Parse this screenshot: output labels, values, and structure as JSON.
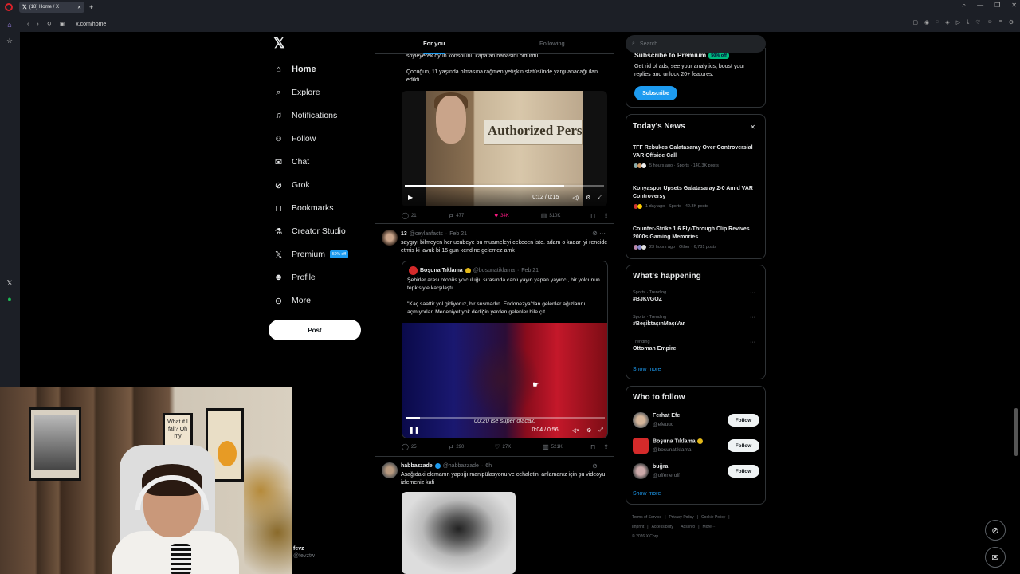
{
  "browser": {
    "tab_title": "(18) Home / X",
    "tab_icon": "x-logo-icon",
    "url": "x.com/home"
  },
  "nav": {
    "items": [
      {
        "label": "Home",
        "icon": "home-icon"
      },
      {
        "label": "Explore",
        "icon": "search-icon"
      },
      {
        "label": "Notifications",
        "icon": "bell-icon",
        "badge": "18"
      },
      {
        "label": "Follow",
        "icon": "person-add-icon"
      },
      {
        "label": "Chat",
        "icon": "mail-icon"
      },
      {
        "label": "Grok",
        "icon": "grok-icon"
      },
      {
        "label": "Bookmarks",
        "icon": "bookmark-icon"
      },
      {
        "label": "Creator Studio",
        "icon": "flask-icon"
      },
      {
        "label": "Premium",
        "icon": "x-logo-icon",
        "badge": "50% off"
      },
      {
        "label": "Profile",
        "icon": "person-icon"
      },
      {
        "label": "More",
        "icon": "more-circle-icon"
      }
    ],
    "post_label": "Post"
  },
  "account": {
    "name": "fevz",
    "handle": "@fevztw"
  },
  "feed": {
    "tabs": [
      "For you",
      "Following"
    ],
    "tweet1": {
      "text_line1": "söyleyerek oyun konsolunu kapatan babasını öldürdü.",
      "text_line2": "Çocuğun, 11 yaşında olmasına rağmen yetişkin statüsünde yargılanacağı ilan edildi.",
      "video_sign": "Authorized Pers",
      "video_time": "0:12 / 0:15",
      "video_progress": 0.8,
      "replies": "21",
      "reposts": "477",
      "likes": "34K",
      "views": "$10K"
    },
    "tweet2": {
      "name": "13",
      "handle": "@ceylanfacts",
      "date": "Feb 21",
      "text": "saygıyı bilmeyen her ucubeye bu muameleyi cekecen iste. adam o kadar iyi rencide etmis ki lavuk bi 15 gun kendine gelemez amk",
      "quote": {
        "name": "Boşuna Tıklama",
        "handle": "@bosunatiklama",
        "date": "Feb 21",
        "text1": "Şehirler arası otobüs yolculuğu sırasında canlı yayın yapan yayıncı, bir yolcunun tepkisiyle karşılaştı.",
        "text2": "\"Kaç saattir yol gidiyoruz, bir susmadın. Endonezya'dan gelenler ağızlarını açmıyorlar. Medeniyet yok dediğin yerden gelenler bile çıt ...",
        "subtitle": "00:20 ise süper olacak.",
        "video_time": "0:04 / 0:56",
        "video_progress": 0.07
      },
      "replies": "25",
      "reposts": "290",
      "likes": "27K",
      "views": "521K"
    },
    "tweet3": {
      "name": "habbazzade",
      "handle": "@habbazzade",
      "date": "6h",
      "text": "Aşağıdaki elemanın yaptığı manipülasyonu ve cehaletini anlamanız için şu videoyu izlemeniz kafi"
    }
  },
  "sidebar": {
    "search_placeholder": "Search",
    "premium": {
      "title": "Subscribe to Premium",
      "badge": "50% off",
      "text": "Get rid of ads, see your analytics, boost your replies and unlock 20+ features.",
      "button": "Subscribe"
    },
    "news": {
      "title": "Today's News",
      "items": [
        {
          "headline": "TFF Rebukes Galatasaray Over Controversial VAR Offside Call",
          "meta": "5 hours ago · Sports · 140.3K posts"
        },
        {
          "headline": "Konyaspor Upsets Galatasaray 2-0 Amid VAR Controversy",
          "meta": "1 day ago · Sports · 42.3K posts"
        },
        {
          "headline": "Counter-Strike 1.6 Fly-Through Clip Revives 2000s Gaming Memories",
          "meta": "23 hours ago · Other · 6,781 posts"
        }
      ]
    },
    "happening": {
      "title": "What's happening",
      "items": [
        {
          "context": "Sports · Trending",
          "topic": "#BJKvGOZ"
        },
        {
          "context": "Sports · Trending",
          "topic": "#BeşiktaşınMaçıVar"
        },
        {
          "context": "Trending",
          "topic": "Ottoman Empire"
        }
      ],
      "show_more": "Show more"
    },
    "who_to_follow": {
      "title": "Who to follow",
      "items": [
        {
          "name": "Ferhat Efe",
          "handle": "@efeuuc",
          "button": "Follow"
        },
        {
          "name": "Boşuna Tıklama",
          "handle": "@bosunatiklama",
          "button": "Follow"
        },
        {
          "name": "buğra",
          "handle": "@offeneroff",
          "button": "Follow"
        }
      ],
      "show_more": "Show more"
    },
    "footer": [
      "Terms of Service",
      "|",
      "Privacy Policy",
      "|",
      "Cookie Policy",
      "|",
      "Imprint",
      "|",
      "Accessibility",
      "|",
      "Ads info",
      "|",
      "More ···",
      "© 2026 X Corp."
    ]
  },
  "webcam": {
    "frame_text": "What if I fall? Oh my"
  },
  "colors": {
    "accent": "#1d9bf0",
    "like": "#f91880",
    "bg": "#000000",
    "muted": "#71767b"
  }
}
